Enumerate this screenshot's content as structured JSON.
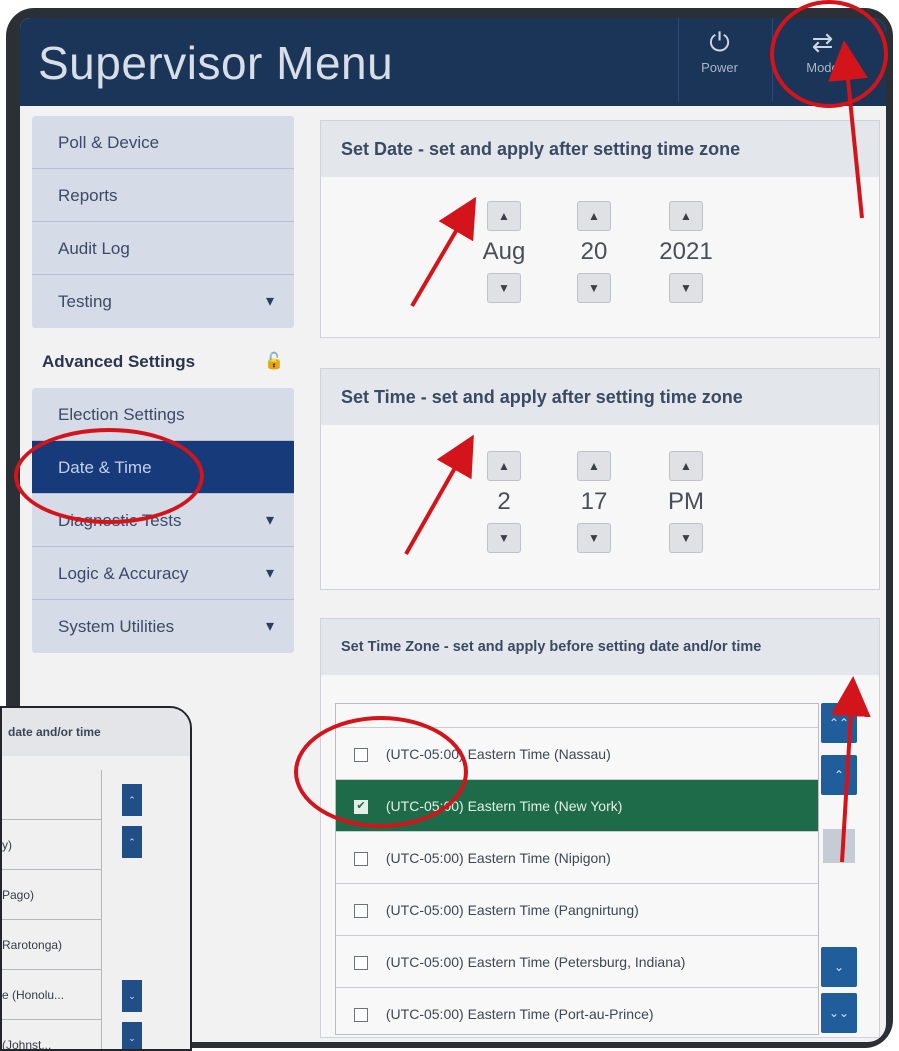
{
  "header": {
    "title": "Supervisor Menu",
    "power_label": "Power",
    "mode_label": "Mode"
  },
  "sidebar": {
    "group1": [
      {
        "label": "Poll & Device"
      },
      {
        "label": "Reports"
      },
      {
        "label": "Audit Log"
      },
      {
        "label": "Testing",
        "has_chevron": true
      }
    ],
    "advanced_heading": "Advanced Settings",
    "group2": [
      {
        "label": "Election Settings"
      },
      {
        "label": "Date & Time",
        "active": true
      },
      {
        "label": "Diagnostic Tests",
        "has_chevron": true
      },
      {
        "label": "Logic & Accuracy",
        "has_chevron": true
      },
      {
        "label": "System Utilities",
        "has_chevron": true
      }
    ]
  },
  "date_panel": {
    "title": "Set Date - set and apply after setting time zone",
    "month": "Aug",
    "day": "20",
    "year": "2021"
  },
  "time_panel": {
    "title": "Set Time - set and apply after setting time zone",
    "hour": "2",
    "minute": "17",
    "ampm": "PM"
  },
  "timezone_panel": {
    "title": "Set Time Zone - set and apply before setting date and/or time",
    "options": [
      {
        "label": "(UTC-05:00) Eastern Time (Nassau)",
        "checked": false
      },
      {
        "label": "(UTC-05:00) Eastern Time (New York)",
        "checked": true
      },
      {
        "label": "(UTC-05:00) Eastern Time (Nipigon)",
        "checked": false
      },
      {
        "label": "(UTC-05:00) Eastern Time (Pangnirtung)",
        "checked": false
      },
      {
        "label": "(UTC-05:00) Eastern Time (Petersburg, Indiana)",
        "checked": false
      },
      {
        "label": "(UTC-05:00) Eastern Time (Port-au-Prince)",
        "checked": false
      }
    ]
  },
  "inset": {
    "title": "date and/or time",
    "rows": [
      "",
      "y)",
      "Pago)",
      "Rarotonga)",
      "e (Honolu...",
      "(Johnst..."
    ]
  },
  "colors": {
    "header_bg": "#1a3558",
    "active_nav": "#163a7a",
    "selected_row": "#1d6b48",
    "scroll_button": "#1f5e9a",
    "annotation_red": "#d3141a"
  }
}
